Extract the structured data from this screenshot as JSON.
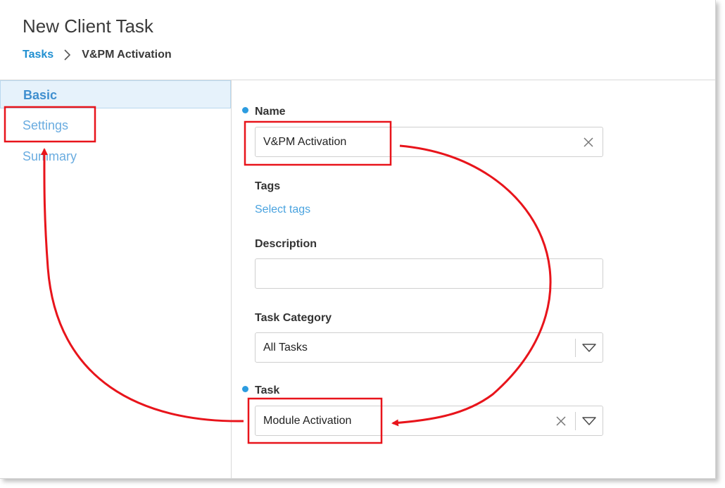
{
  "page": {
    "title": "New Client Task"
  },
  "breadcrumb": {
    "parent": "Tasks",
    "current": "V&PM Activation"
  },
  "sidebar": {
    "items": [
      {
        "label": "Basic",
        "active": true
      },
      {
        "label": "Settings",
        "active": false
      },
      {
        "label": "Summary",
        "active": false
      }
    ]
  },
  "form": {
    "name": {
      "label": "Name",
      "required": true,
      "value": "V&PM Activation"
    },
    "tags": {
      "label": "Tags",
      "link": "Select tags"
    },
    "description": {
      "label": "Description",
      "value": ""
    },
    "task_category": {
      "label": "Task Category",
      "value": "All Tasks"
    },
    "task": {
      "label": "Task",
      "required": true,
      "value": "Module Activation"
    }
  },
  "colors": {
    "accent": "#1f8fd1",
    "required_dot": "#2c9ce0",
    "annotation": "#e8141b",
    "active_bg": "#e6f2fb"
  },
  "icons": [
    "chevron-right-icon",
    "close-icon",
    "dropdown-triangle-icon"
  ]
}
